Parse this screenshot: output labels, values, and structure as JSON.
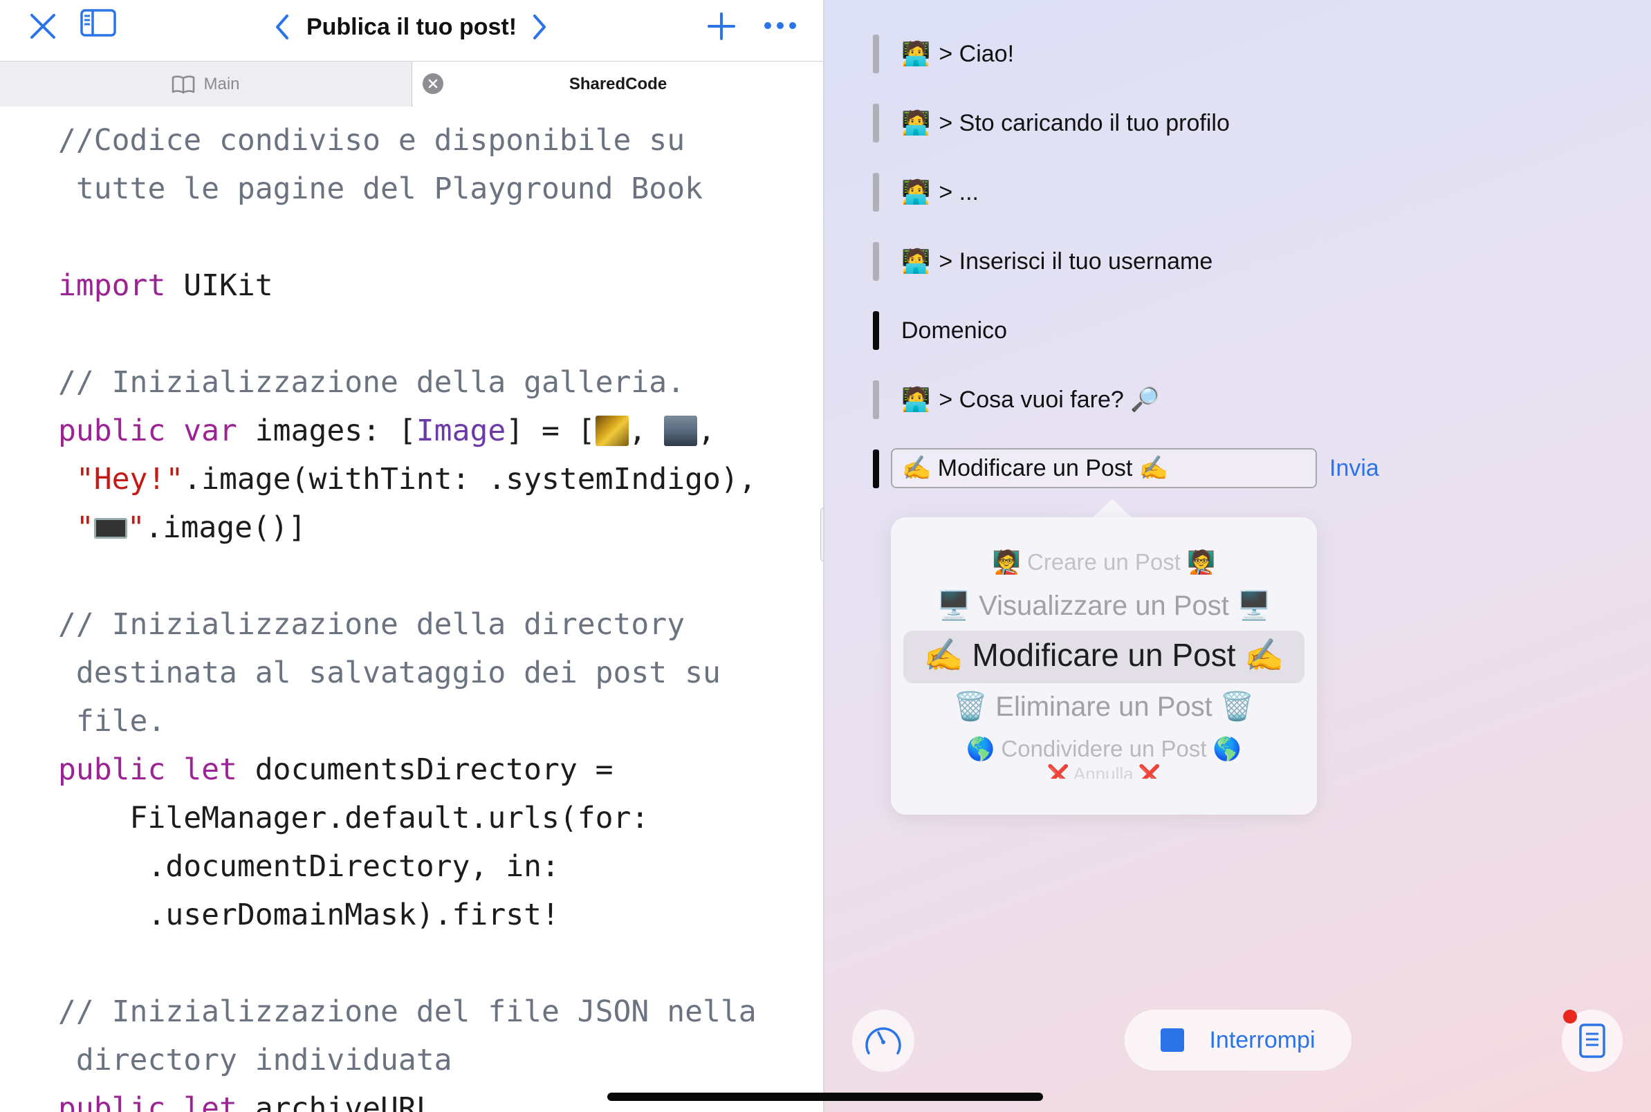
{
  "toolbar": {
    "title": "Publica il tuo post!",
    "icons": [
      "close-icon",
      "sidebar-icon",
      "chevron-left-icon",
      "chevron-right-icon",
      "plus-icon",
      "ellipsis-icon"
    ],
    "accent_color": "#2a74e8"
  },
  "tabs": [
    {
      "label": "Main",
      "icon": "book-icon",
      "active": false
    },
    {
      "label": "SharedCode",
      "icon": "close-circle-icon",
      "active": true
    }
  ],
  "code": {
    "lines": [
      {
        "parts": [
          {
            "t": "//Codice condiviso e disponibile su",
            "c": "cm"
          }
        ]
      },
      {
        "parts": [
          {
            "t": " tutte le pagine del Playground Book",
            "c": "cm"
          }
        ]
      },
      {
        "parts": []
      },
      {
        "parts": [
          {
            "t": "import",
            "c": "kw"
          },
          {
            "t": " UIKit",
            "c": ""
          }
        ]
      },
      {
        "parts": []
      },
      {
        "parts": [
          {
            "t": "// Inizializzazione della galleria.",
            "c": "cm"
          }
        ]
      },
      {
        "parts": [
          {
            "t": "public",
            "c": "kw"
          },
          {
            "t": " ",
            "c": ""
          },
          {
            "t": "var",
            "c": "kw"
          },
          {
            "t": " images: [",
            "c": ""
          },
          {
            "t": "Image",
            "c": "ty"
          },
          {
            "t": "] = [",
            "c": ""
          },
          {
            "img": "thumb1"
          },
          {
            "t": ", ",
            "c": ""
          },
          {
            "img": "thumb2"
          },
          {
            "t": ",",
            "c": ""
          }
        ]
      },
      {
        "parts": [
          {
            "t": " ",
            "c": ""
          },
          {
            "t": "\"Hey!\"",
            "c": "st"
          },
          {
            "t": ".image(withTint: .systemIndigo),",
            "c": ""
          }
        ]
      },
      {
        "parts": [
          {
            "t": " ",
            "c": ""
          },
          {
            "t": "\"",
            "c": "st"
          },
          {
            "img": "monitor"
          },
          {
            "t": "\"",
            "c": "st"
          },
          {
            "t": ".image()]",
            "c": ""
          }
        ]
      },
      {
        "parts": []
      },
      {
        "parts": [
          {
            "t": "// Inizializzazione della directory",
            "c": "cm"
          }
        ]
      },
      {
        "parts": [
          {
            "t": " destinata al salvataggio dei post su",
            "c": "cm"
          }
        ]
      },
      {
        "parts": [
          {
            "t": " file.",
            "c": "cm"
          }
        ]
      },
      {
        "parts": [
          {
            "t": "public",
            "c": "kw"
          },
          {
            "t": " ",
            "c": ""
          },
          {
            "t": "let",
            "c": "kw"
          },
          {
            "t": " documentsDirectory =",
            "c": ""
          }
        ]
      },
      {
        "parts": [
          {
            "t": "    FileManager.default.urls(for:",
            "c": ""
          }
        ]
      },
      {
        "parts": [
          {
            "t": "     .documentDirectory, in:",
            "c": ""
          }
        ]
      },
      {
        "parts": [
          {
            "t": "     .userDomainMask).first!",
            "c": ""
          }
        ]
      },
      {
        "parts": []
      },
      {
        "parts": [
          {
            "t": "// Inizializzazione del file JSON nella",
            "c": "cm"
          }
        ]
      },
      {
        "parts": [
          {
            "t": " directory individuata",
            "c": "cm"
          }
        ]
      },
      {
        "parts": [
          {
            "t": "public",
            "c": "kw"
          },
          {
            "t": " ",
            "c": ""
          },
          {
            "t": "let",
            "c": "kw"
          },
          {
            "t": " archiveURL",
            "c": ""
          }
        ]
      }
    ]
  },
  "console": {
    "messages": [
      {
        "emoji": "🧑‍💻",
        "text": "> Ciao!",
        "user": false
      },
      {
        "emoji": "🧑‍💻",
        "text": "> Sto caricando il tuo profilo",
        "user": false
      },
      {
        "emoji": "🧑‍💻",
        "text": "> ...",
        "user": false
      },
      {
        "emoji": "🧑‍💻",
        "text": "> Inserisci il tuo username",
        "user": false
      },
      {
        "emoji": "",
        "text": "Domenico",
        "user": true
      },
      {
        "emoji": "🧑‍💻",
        "text": "> Cosa vuoi fare? 🔎",
        "user": false
      }
    ],
    "input_value": "✍️ Modificare un Post ✍️",
    "send_label": "Invia",
    "picker_options": [
      "🧑‍🏫 Creare un Post 🧑‍🏫",
      "🖥️ Visualizzare un Post 🖥️",
      "✍️ Modificare un Post ✍️",
      "🗑️ Eliminare un Post 🗑️",
      "🌎 Condividere un Post 🌎",
      "❌ Annulla ❌"
    ],
    "picker_selected_index": 2
  },
  "controls": {
    "stop_label": "Interrompi",
    "icons": [
      "speedometer-icon",
      "stop-icon",
      "log-icon"
    ],
    "notification_color": "#e8281e"
  }
}
